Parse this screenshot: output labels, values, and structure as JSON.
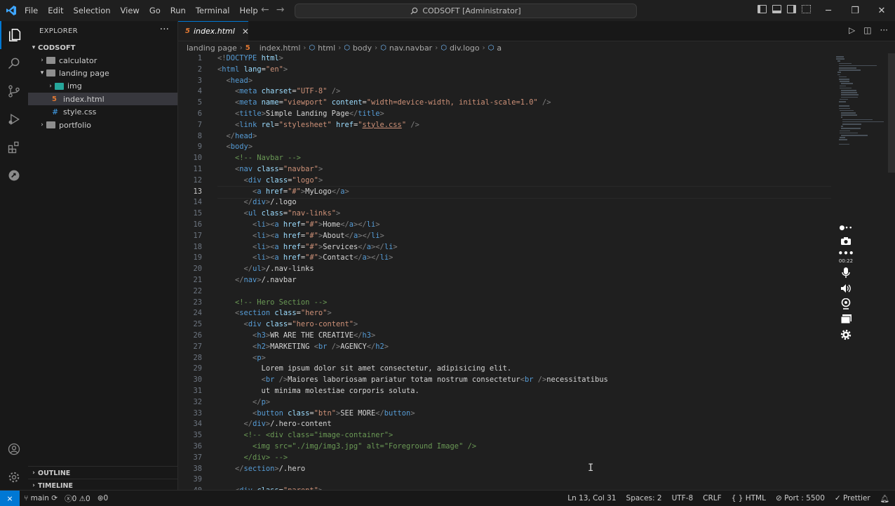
{
  "titlebar": {
    "menu": [
      "File",
      "Edit",
      "Selection",
      "View",
      "Go",
      "Run",
      "Terminal",
      "Help"
    ],
    "search_text": "CODSOFT [Administrator]"
  },
  "explorer": {
    "title": "EXPLORER",
    "root": "CODSOFT",
    "items": [
      {
        "label": "calculator",
        "kind": "folder",
        "expanded": false
      },
      {
        "label": "landing page",
        "kind": "folder",
        "expanded": true
      },
      {
        "label": "img",
        "kind": "folder-img",
        "expanded": false
      },
      {
        "label": "index.html",
        "kind": "html",
        "selected": true
      },
      {
        "label": "style.css",
        "kind": "css"
      },
      {
        "label": "portfolio",
        "kind": "folder",
        "expanded": false
      }
    ],
    "outline": "OUTLINE",
    "timeline": "TIMELINE"
  },
  "editor": {
    "tab_label": "index.html",
    "breadcrumb": [
      "landing page",
      "index.html",
      "html",
      "body",
      "nav.navbar",
      "div.logo",
      "a"
    ],
    "current_line": 13,
    "lines": [
      [
        [
          "p",
          "<!"
        ],
        [
          "tag",
          "DOCTYPE"
        ],
        [
          "attr",
          " html"
        ],
        [
          "p",
          ">"
        ]
      ],
      [
        [
          "p",
          "<"
        ],
        [
          "tag",
          "html"
        ],
        [
          "attr",
          " lang"
        ],
        [
          "txt",
          "="
        ],
        [
          "str",
          "\"en\""
        ],
        [
          "p",
          ">"
        ]
      ],
      [
        [
          "txt",
          "  "
        ],
        [
          "p",
          "<"
        ],
        [
          "tag",
          "head"
        ],
        [
          "p",
          ">"
        ]
      ],
      [
        [
          "txt",
          "    "
        ],
        [
          "p",
          "<"
        ],
        [
          "tag",
          "meta"
        ],
        [
          "attr",
          " charset"
        ],
        [
          "txt",
          "="
        ],
        [
          "str",
          "\"UTF-8\""
        ],
        [
          "p",
          " />"
        ]
      ],
      [
        [
          "txt",
          "    "
        ],
        [
          "p",
          "<"
        ],
        [
          "tag",
          "meta"
        ],
        [
          "attr",
          " name"
        ],
        [
          "txt",
          "="
        ],
        [
          "str",
          "\"viewport\""
        ],
        [
          "attr",
          " content"
        ],
        [
          "txt",
          "="
        ],
        [
          "str",
          "\"width=device-width, initial-scale=1.0\""
        ],
        [
          "p",
          " />"
        ]
      ],
      [
        [
          "txt",
          "    "
        ],
        [
          "p",
          "<"
        ],
        [
          "tag",
          "title"
        ],
        [
          "p",
          ">"
        ],
        [
          "txt",
          "Simple Landing Page"
        ],
        [
          "p",
          "</"
        ],
        [
          "tag",
          "title"
        ],
        [
          "p",
          ">"
        ]
      ],
      [
        [
          "txt",
          "    "
        ],
        [
          "p",
          "<"
        ],
        [
          "tag",
          "link"
        ],
        [
          "attr",
          " rel"
        ],
        [
          "txt",
          "="
        ],
        [
          "str",
          "\"stylesheet\""
        ],
        [
          "attr",
          " href"
        ],
        [
          "txt",
          "="
        ],
        [
          "str",
          "\""
        ],
        [
          "stru",
          "style.css"
        ],
        [
          "str",
          "\""
        ],
        [
          "p",
          " />"
        ]
      ],
      [
        [
          "txt",
          "  "
        ],
        [
          "p",
          "</"
        ],
        [
          "tag",
          "head"
        ],
        [
          "p",
          ">"
        ]
      ],
      [
        [
          "txt",
          "  "
        ],
        [
          "p",
          "<"
        ],
        [
          "tag",
          "body"
        ],
        [
          "p",
          ">"
        ]
      ],
      [
        [
          "txt",
          "    "
        ],
        [
          "cmt",
          "<!-- Navbar -->"
        ]
      ],
      [
        [
          "txt",
          "    "
        ],
        [
          "p",
          "<"
        ],
        [
          "tag",
          "nav"
        ],
        [
          "attr",
          " class"
        ],
        [
          "txt",
          "="
        ],
        [
          "str",
          "\"navbar\""
        ],
        [
          "p",
          ">"
        ]
      ],
      [
        [
          "txt",
          "      "
        ],
        [
          "p",
          "<"
        ],
        [
          "tag",
          "div"
        ],
        [
          "attr",
          " class"
        ],
        [
          "txt",
          "="
        ],
        [
          "str",
          "\"logo\""
        ],
        [
          "p",
          ">"
        ]
      ],
      [
        [
          "txt",
          "        "
        ],
        [
          "p",
          "<"
        ],
        [
          "tag",
          "a"
        ],
        [
          "attr",
          " href"
        ],
        [
          "txt",
          "="
        ],
        [
          "str",
          "\"#\""
        ],
        [
          "p",
          ">"
        ],
        [
          "txt",
          "MyLogo"
        ],
        [
          "p",
          "</"
        ],
        [
          "tag",
          "a"
        ],
        [
          "p",
          ">"
        ]
      ],
      [
        [
          "txt",
          "      "
        ],
        [
          "p",
          "</"
        ],
        [
          "tag",
          "div"
        ],
        [
          "p",
          ">"
        ],
        [
          "txt",
          "/.logo"
        ]
      ],
      [
        [
          "txt",
          "      "
        ],
        [
          "p",
          "<"
        ],
        [
          "tag",
          "ul"
        ],
        [
          "attr",
          " class"
        ],
        [
          "txt",
          "="
        ],
        [
          "str",
          "\"nav-links\""
        ],
        [
          "p",
          ">"
        ]
      ],
      [
        [
          "txt",
          "        "
        ],
        [
          "p",
          "<"
        ],
        [
          "tag",
          "li"
        ],
        [
          "p",
          "><"
        ],
        [
          "tag",
          "a"
        ],
        [
          "attr",
          " href"
        ],
        [
          "txt",
          "="
        ],
        [
          "str",
          "\"#\""
        ],
        [
          "p",
          ">"
        ],
        [
          "txt",
          "Home"
        ],
        [
          "p",
          "</"
        ],
        [
          "tag",
          "a"
        ],
        [
          "p",
          "></"
        ],
        [
          "tag",
          "li"
        ],
        [
          "p",
          ">"
        ]
      ],
      [
        [
          "txt",
          "        "
        ],
        [
          "p",
          "<"
        ],
        [
          "tag",
          "li"
        ],
        [
          "p",
          "><"
        ],
        [
          "tag",
          "a"
        ],
        [
          "attr",
          " href"
        ],
        [
          "txt",
          "="
        ],
        [
          "str",
          "\"#\""
        ],
        [
          "p",
          ">"
        ],
        [
          "txt",
          "About"
        ],
        [
          "p",
          "</"
        ],
        [
          "tag",
          "a"
        ],
        [
          "p",
          "></"
        ],
        [
          "tag",
          "li"
        ],
        [
          "p",
          ">"
        ]
      ],
      [
        [
          "txt",
          "        "
        ],
        [
          "p",
          "<"
        ],
        [
          "tag",
          "li"
        ],
        [
          "p",
          "><"
        ],
        [
          "tag",
          "a"
        ],
        [
          "attr",
          " href"
        ],
        [
          "txt",
          "="
        ],
        [
          "str",
          "\"#\""
        ],
        [
          "p",
          ">"
        ],
        [
          "txt",
          "Services"
        ],
        [
          "p",
          "</"
        ],
        [
          "tag",
          "a"
        ],
        [
          "p",
          "></"
        ],
        [
          "tag",
          "li"
        ],
        [
          "p",
          ">"
        ]
      ],
      [
        [
          "txt",
          "        "
        ],
        [
          "p",
          "<"
        ],
        [
          "tag",
          "li"
        ],
        [
          "p",
          "><"
        ],
        [
          "tag",
          "a"
        ],
        [
          "attr",
          " href"
        ],
        [
          "txt",
          "="
        ],
        [
          "str",
          "\"#\""
        ],
        [
          "p",
          ">"
        ],
        [
          "txt",
          "Contact"
        ],
        [
          "p",
          "</"
        ],
        [
          "tag",
          "a"
        ],
        [
          "p",
          "></"
        ],
        [
          "tag",
          "li"
        ],
        [
          "p",
          ">"
        ]
      ],
      [
        [
          "txt",
          "      "
        ],
        [
          "p",
          "</"
        ],
        [
          "tag",
          "ul"
        ],
        [
          "p",
          ">"
        ],
        [
          "txt",
          "/.nav-links"
        ]
      ],
      [
        [
          "txt",
          "    "
        ],
        [
          "p",
          "</"
        ],
        [
          "tag",
          "nav"
        ],
        [
          "p",
          ">"
        ],
        [
          "txt",
          "/.navbar"
        ]
      ],
      [],
      [
        [
          "txt",
          "    "
        ],
        [
          "cmt",
          "<!-- Hero Section -->"
        ]
      ],
      [
        [
          "txt",
          "    "
        ],
        [
          "p",
          "<"
        ],
        [
          "tag",
          "section"
        ],
        [
          "attr",
          " class"
        ],
        [
          "txt",
          "="
        ],
        [
          "str",
          "\"hero\""
        ],
        [
          "p",
          ">"
        ]
      ],
      [
        [
          "txt",
          "      "
        ],
        [
          "p",
          "<"
        ],
        [
          "tag",
          "div"
        ],
        [
          "attr",
          " class"
        ],
        [
          "txt",
          "="
        ],
        [
          "str",
          "\"hero-content\""
        ],
        [
          "p",
          ">"
        ]
      ],
      [
        [
          "txt",
          "        "
        ],
        [
          "p",
          "<"
        ],
        [
          "tag",
          "h3"
        ],
        [
          "p",
          ">"
        ],
        [
          "txt",
          "WR ARE THE CREATIVE"
        ],
        [
          "p",
          "</"
        ],
        [
          "tag",
          "h3"
        ],
        [
          "p",
          ">"
        ]
      ],
      [
        [
          "txt",
          "        "
        ],
        [
          "p",
          "<"
        ],
        [
          "tag",
          "h2"
        ],
        [
          "p",
          ">"
        ],
        [
          "txt",
          "MARKETING "
        ],
        [
          "p",
          "<"
        ],
        [
          "tag",
          "br"
        ],
        [
          "p",
          " />"
        ],
        [
          "txt",
          "AGENCY"
        ],
        [
          "p",
          "</"
        ],
        [
          "tag",
          "h2"
        ],
        [
          "p",
          ">"
        ]
      ],
      [
        [
          "txt",
          "        "
        ],
        [
          "p",
          "<"
        ],
        [
          "tag",
          "p"
        ],
        [
          "p",
          ">"
        ]
      ],
      [
        [
          "txt",
          "          Lorem ipsum dolor sit amet consectetur, adipisicing elit."
        ]
      ],
      [
        [
          "txt",
          "          "
        ],
        [
          "p",
          "<"
        ],
        [
          "tag",
          "br"
        ],
        [
          "p",
          " />"
        ],
        [
          "txt",
          "Maiores laboriosam pariatur totam nostrum consectetur"
        ],
        [
          "p",
          "<"
        ],
        [
          "tag",
          "br"
        ],
        [
          "p",
          " />"
        ],
        [
          "txt",
          "necessitatibus"
        ]
      ],
      [
        [
          "txt",
          "          ut minima molestiae corporis soluta."
        ]
      ],
      [
        [
          "txt",
          "        "
        ],
        [
          "p",
          "</"
        ],
        [
          "tag",
          "p"
        ],
        [
          "p",
          ">"
        ]
      ],
      [
        [
          "txt",
          "        "
        ],
        [
          "p",
          "<"
        ],
        [
          "tag",
          "button"
        ],
        [
          "attr",
          " class"
        ],
        [
          "txt",
          "="
        ],
        [
          "str",
          "\"btn\""
        ],
        [
          "p",
          ">"
        ],
        [
          "txt",
          "SEE MORE"
        ],
        [
          "p",
          "</"
        ],
        [
          "tag",
          "button"
        ],
        [
          "p",
          ">"
        ]
      ],
      [
        [
          "txt",
          "      "
        ],
        [
          "p",
          "</"
        ],
        [
          "tag",
          "div"
        ],
        [
          "p",
          ">"
        ],
        [
          "txt",
          "/.hero-content"
        ]
      ],
      [
        [
          "txt",
          "      "
        ],
        [
          "cmt",
          "<!-- <div class=\"image-container\">"
        ]
      ],
      [
        [
          "txt",
          "        "
        ],
        [
          "cmt",
          "<img src=\"./img/img3.jpg\" alt=\"Foreground Image\" />"
        ]
      ],
      [
        [
          "txt",
          "      "
        ],
        [
          "cmt",
          "</div> -->"
        ]
      ],
      [
        [
          "txt",
          "    "
        ],
        [
          "p",
          "</"
        ],
        [
          "tag",
          "section"
        ],
        [
          "p",
          ">"
        ],
        [
          "txt",
          "/.hero"
        ]
      ],
      [],
      [
        [
          "txt",
          "    "
        ],
        [
          "p",
          "<"
        ],
        [
          "tag",
          "div"
        ],
        [
          "attr",
          " class"
        ],
        [
          "txt",
          "="
        ],
        [
          "str",
          "\"parent\""
        ],
        [
          "p",
          ">"
        ]
      ]
    ]
  },
  "recorder": {
    "time": "00:22"
  },
  "statusbar": {
    "branch": "main",
    "errors": "0",
    "warnings": "0",
    "ports": "0",
    "position": "Ln 13, Col 31",
    "spaces": "Spaces: 2",
    "encoding": "UTF-8",
    "eol": "CRLF",
    "language": "HTML",
    "port": "Port : 5500",
    "prettier": "Prettier"
  },
  "colors": {
    "accent": "#0078d4",
    "bg": "#1f1f1f",
    "sidebar": "#181818"
  }
}
